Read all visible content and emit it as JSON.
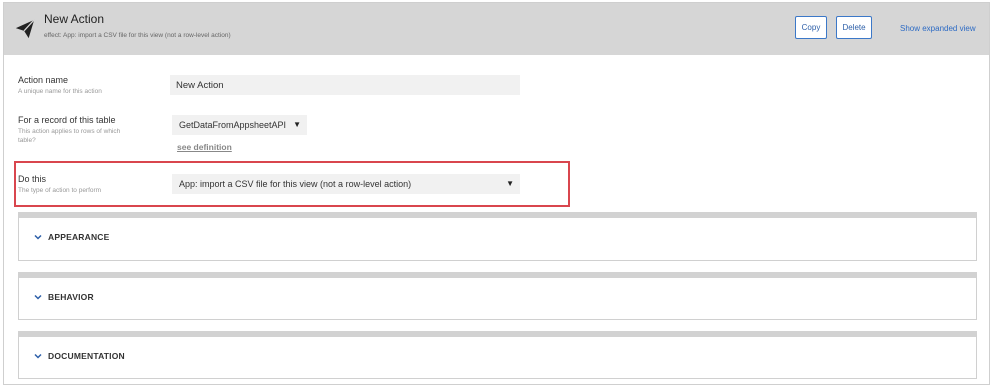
{
  "header": {
    "title": "New Action",
    "subtitle": "effect: App: import a CSV file for this view (not a row-level action)",
    "copy_label": "Copy",
    "delete_label": "Delete",
    "expand_label": "Show expanded view"
  },
  "fields": {
    "action_name": {
      "label": "Action name",
      "help": "A unique name for this action",
      "value": "New Action"
    },
    "table": {
      "label": "For a record of this table",
      "help": "This action applies to rows of which table?",
      "value": "GetDataFromAppsheetAPI",
      "see_definition": "see definition"
    },
    "do_this": {
      "label": "Do this",
      "help": "The type of action to perform",
      "value": "App: import a CSV file for this view (not a row-level action)"
    }
  },
  "sections": [
    {
      "label": "APPEARANCE"
    },
    {
      "label": "BEHAVIOR"
    },
    {
      "label": "DOCUMENTATION"
    }
  ],
  "icons": {
    "header": "paper-plane-icon",
    "dropdown": "caret-down-icon",
    "section": "chevron-down-icon"
  },
  "colors": {
    "header_bg": "#d6d6d6",
    "button_border": "#3c78c8",
    "highlight": "#d9464e",
    "link": "#2d6bc4"
  }
}
